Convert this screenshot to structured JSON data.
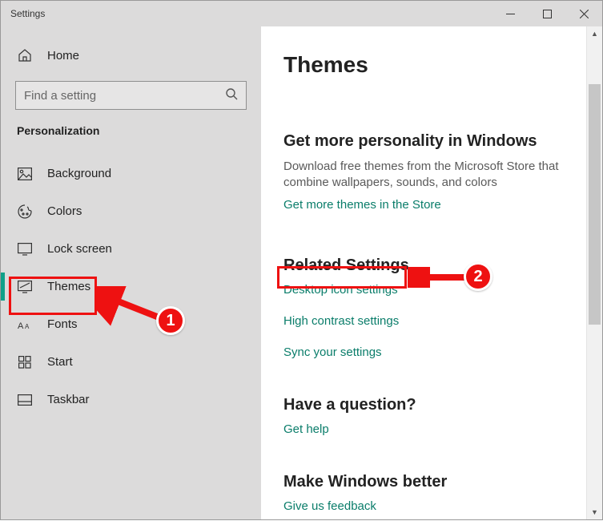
{
  "window": {
    "title": "Settings"
  },
  "sidebar": {
    "home": "Home",
    "search_placeholder": "Find a setting",
    "section": "Personalization",
    "items": [
      {
        "label": "Background"
      },
      {
        "label": "Colors"
      },
      {
        "label": "Lock screen"
      },
      {
        "label": "Themes"
      },
      {
        "label": "Fonts"
      },
      {
        "label": "Start"
      },
      {
        "label": "Taskbar"
      }
    ]
  },
  "main": {
    "heading": "Themes",
    "promo": {
      "title": "Get more personality in Windows",
      "body": "Download free themes from the Microsoft Store that combine wallpapers, sounds, and colors",
      "link": "Get more themes in the Store"
    },
    "related": {
      "title": "Related Settings",
      "links": [
        "Desktop icon settings",
        "High contrast settings",
        "Sync your settings"
      ]
    },
    "question": {
      "title": "Have a question?",
      "link": "Get help"
    },
    "better": {
      "title": "Make Windows better",
      "link": "Give us feedback"
    }
  },
  "annotations": {
    "1": "1",
    "2": "2"
  }
}
